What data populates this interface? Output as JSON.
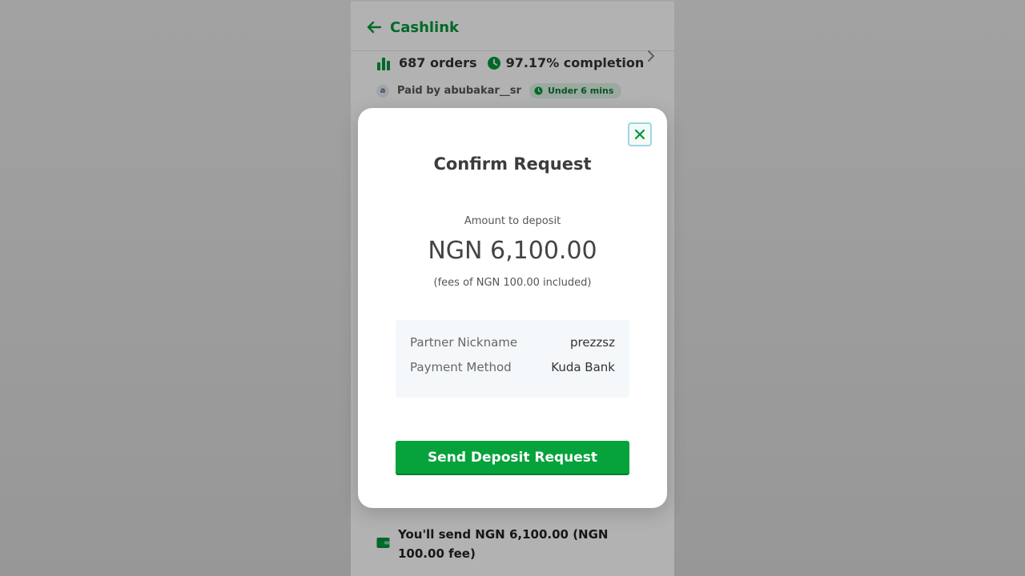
{
  "header": {
    "title": "Cashlink"
  },
  "offers": [
    {
      "orders": "687 orders",
      "completion": "97.17% completion",
      "paid_by": "Paid by abubakar__sr",
      "avatar_initial": "a",
      "time_badge": "Under 6 mins"
    }
  ],
  "bottom_note": "You'll send NGN 6,100.00 (NGN 100.00 fee)",
  "modal": {
    "title": "Confirm Request",
    "amount_label": "Amount to deposit",
    "amount_value": "NGN 6,100.00",
    "fee_note": "(fees of NGN 100.00 included)",
    "details": [
      {
        "key": "Partner Nickname",
        "value": "prezzsz"
      },
      {
        "key": "Payment Method",
        "value": "Kuda Bank"
      }
    ],
    "send_button_label": "Send Deposit Request"
  },
  "colors": {
    "brand_green": "#00973a",
    "button_green": "#06a23c"
  },
  "icons": {
    "back": "arrow-left-icon",
    "orders": "bar-chart-icon",
    "completion": "clock-icon",
    "chevron": "chevron-right-icon",
    "close": "close-icon",
    "wallet": "wallet-icon"
  }
}
